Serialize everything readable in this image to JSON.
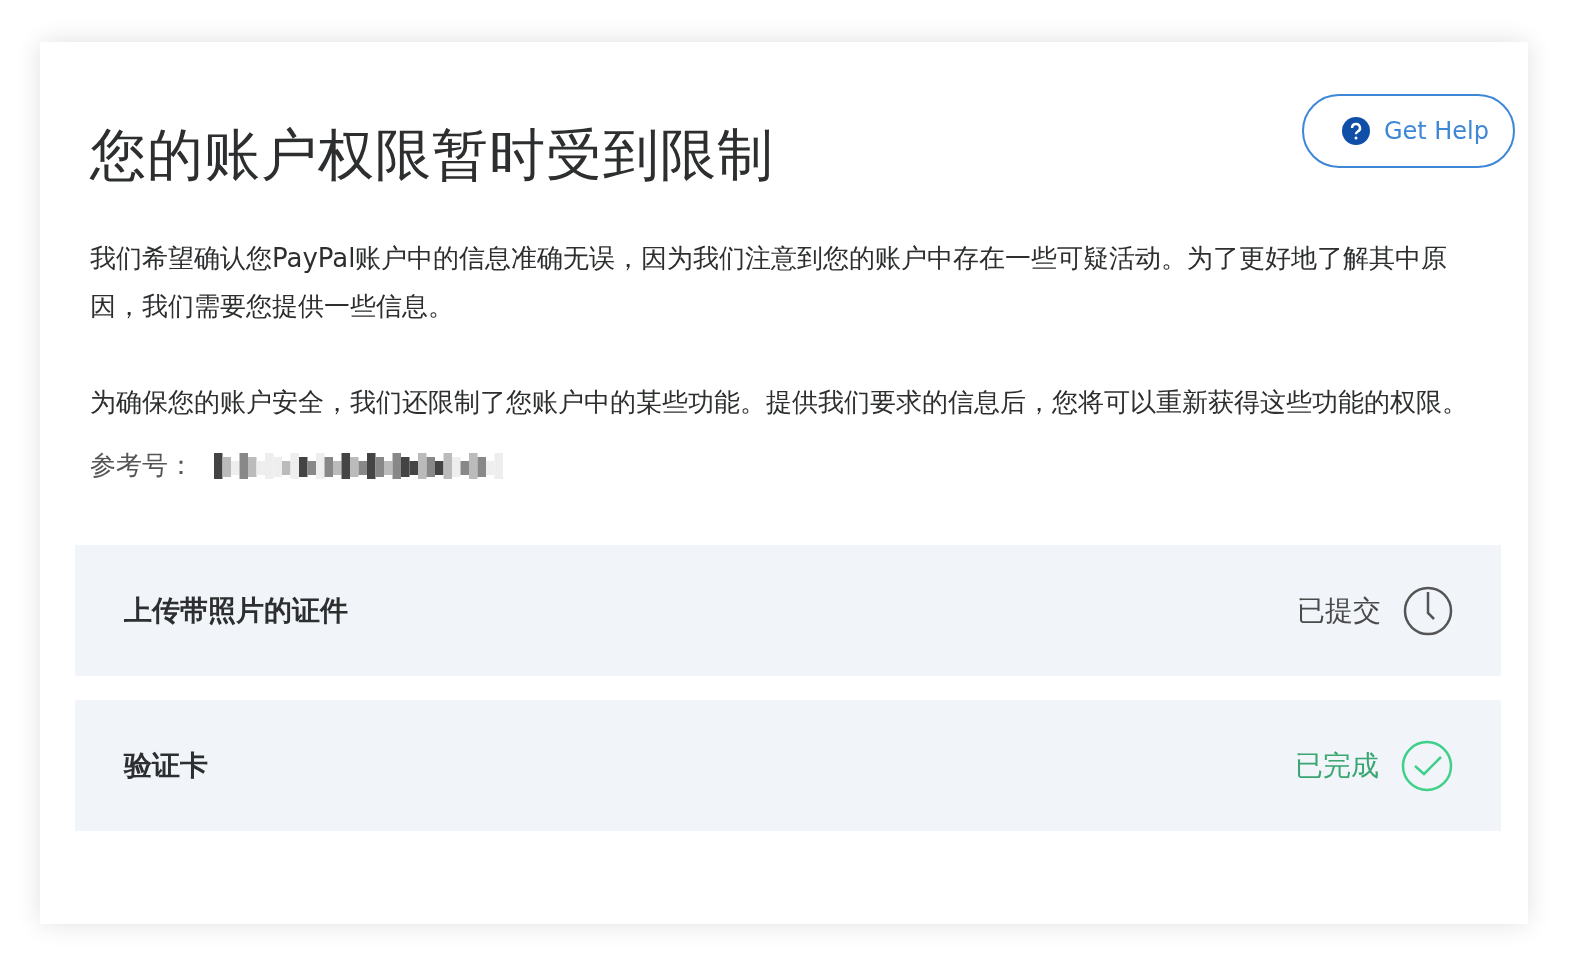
{
  "title": "您的账户权限暂时受到限制",
  "help_button": {
    "label": "Get Help"
  },
  "paragraphs": [
    "我们希望确认您PayPal账户中的信息准确无误，因为我们注意到您的账户中存在一些可疑活动。为了更好地了解其中原因，我们需要您提供一些信息。",
    "为确保您的账户安全，我们还限制了您账户中的某些功能。提供我们要求的信息后，您将可以重新获得这些功能的权限。"
  ],
  "reference": {
    "label": "参考号："
  },
  "tasks": [
    {
      "label": "上传带照片的证件",
      "status": "已提交",
      "kind": "submitted"
    },
    {
      "label": "验证卡",
      "status": "已完成",
      "kind": "completed"
    }
  ]
}
